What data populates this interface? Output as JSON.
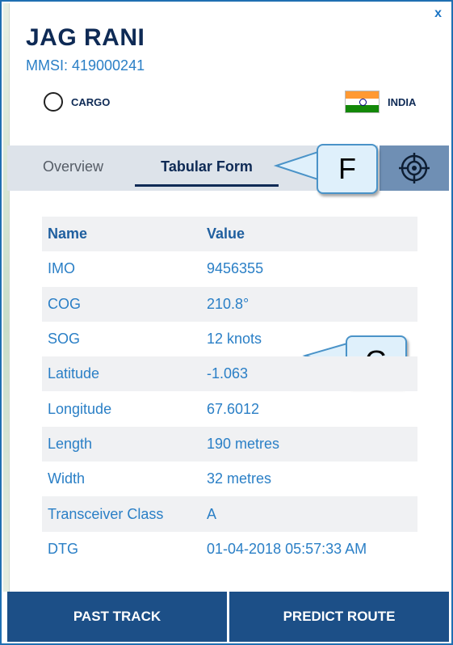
{
  "header": {
    "close_label": "x",
    "ship_name": "JAG RANI",
    "mmsi": "MMSI: 419000241",
    "vessel_type": "CARGO",
    "flag_country": "INDIA"
  },
  "tabs": {
    "overview": "Overview",
    "tabular": "Tabular Form",
    "active": "Tabular Form"
  },
  "callouts": {
    "f": "F",
    "g": "G"
  },
  "table": {
    "columns": [
      "Name",
      "Value"
    ],
    "rows": [
      {
        "name": "IMO",
        "value": "9456355"
      },
      {
        "name": "COG",
        "value": "210.8°"
      },
      {
        "name": "SOG",
        "value": "12 knots"
      },
      {
        "name": "Latitude",
        "value": "-1.063"
      },
      {
        "name": "Longitude",
        "value": "67.6012"
      },
      {
        "name": "Length",
        "value": "190 metres"
      },
      {
        "name": "Width",
        "value": "32 metres"
      },
      {
        "name": "Transceiver Class",
        "value": "A"
      },
      {
        "name": "DTG",
        "value": "01-04-2018 05:57:33 AM"
      }
    ]
  },
  "footer": {
    "past_track": "PAST TRACK",
    "predict_route": "PREDICT ROUTE"
  },
  "icons": {
    "locate": "crosshair-target-icon",
    "type_marker": "circle-icon",
    "flag": "india-flag-icon"
  },
  "colors": {
    "title": "#0e2a55",
    "accent": "#2a7fc6",
    "footer_button": "#1c4f87",
    "tab_bar": "#dde3ea",
    "locate_button": "#6f8fb4"
  }
}
